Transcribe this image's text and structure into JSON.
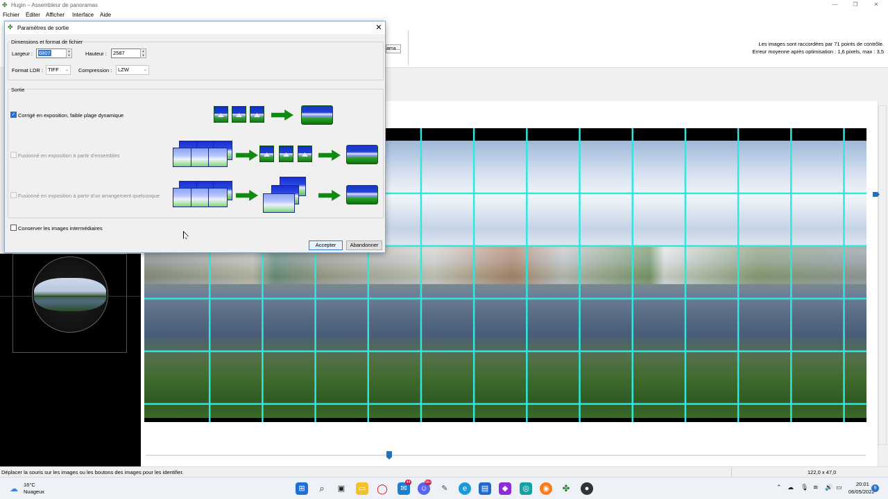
{
  "window": {
    "title": "Hugin – Assembleur de panoramas",
    "menu": [
      "Fichier",
      "Éditer",
      "Afficher",
      "Interface",
      "Aide"
    ],
    "control_points_info": "Les images sont raccordées par 71 points de contrôle.",
    "optimization_info": "Erreur moyenne après optimisation : 1,6 pixels, max : 3,5",
    "truncated_button_label": "ama..."
  },
  "dialog": {
    "title": "Paramètres de sortie",
    "size_group": {
      "label": "Dimensions et format de fichier",
      "width_label": "Largeur :",
      "width_value": "6807",
      "height_label": "Hauteur :",
      "height_value": "2587",
      "format_label": "Format LDR :",
      "format_value": "TIFF",
      "compression_label": "Compression :",
      "compression_value": "LZW"
    },
    "output_group": {
      "label": "Sortie",
      "options": [
        {
          "label": "Corrigé en exposition, faible plage dynamique",
          "checked": true,
          "enabled": true
        },
        {
          "label": "Fusionné en exposition à partir d'ensembles",
          "checked": false,
          "enabled": false
        },
        {
          "label": "Fusionné en exposition à partir d'un arrangement quelconque",
          "checked": false,
          "enabled": false
        }
      ]
    },
    "keep_intermediate_label": "Conserver les images intermédiaires",
    "accept_label": "Accepter",
    "cancel_label": "Abandonner"
  },
  "statusbar": {
    "message": "Déplacer la souris sur les images ou les boutons des images pour les identifier.",
    "coords": "122,0 x 47,0"
  },
  "taskbar": {
    "weather_temp": "16°C",
    "weather_desc": "Nuageux",
    "time": "20:01",
    "date": "06/05/2022",
    "notification_count": "9",
    "badges": [
      "44",
      "99+"
    ]
  },
  "colors": {
    "grid_line": "#2ee8e0",
    "accent": "#1e73be",
    "arrow_green": "#118a11"
  },
  "icons": [
    "hugin-icon",
    "windows-start-icon",
    "search-icon",
    "task-view-icon",
    "file-explorer-icon",
    "opera-icon",
    "mail-icon",
    "discord-icon",
    "edge-icon",
    "store-icon",
    "firefox-icon",
    "hugin-taskbar-icon"
  ]
}
